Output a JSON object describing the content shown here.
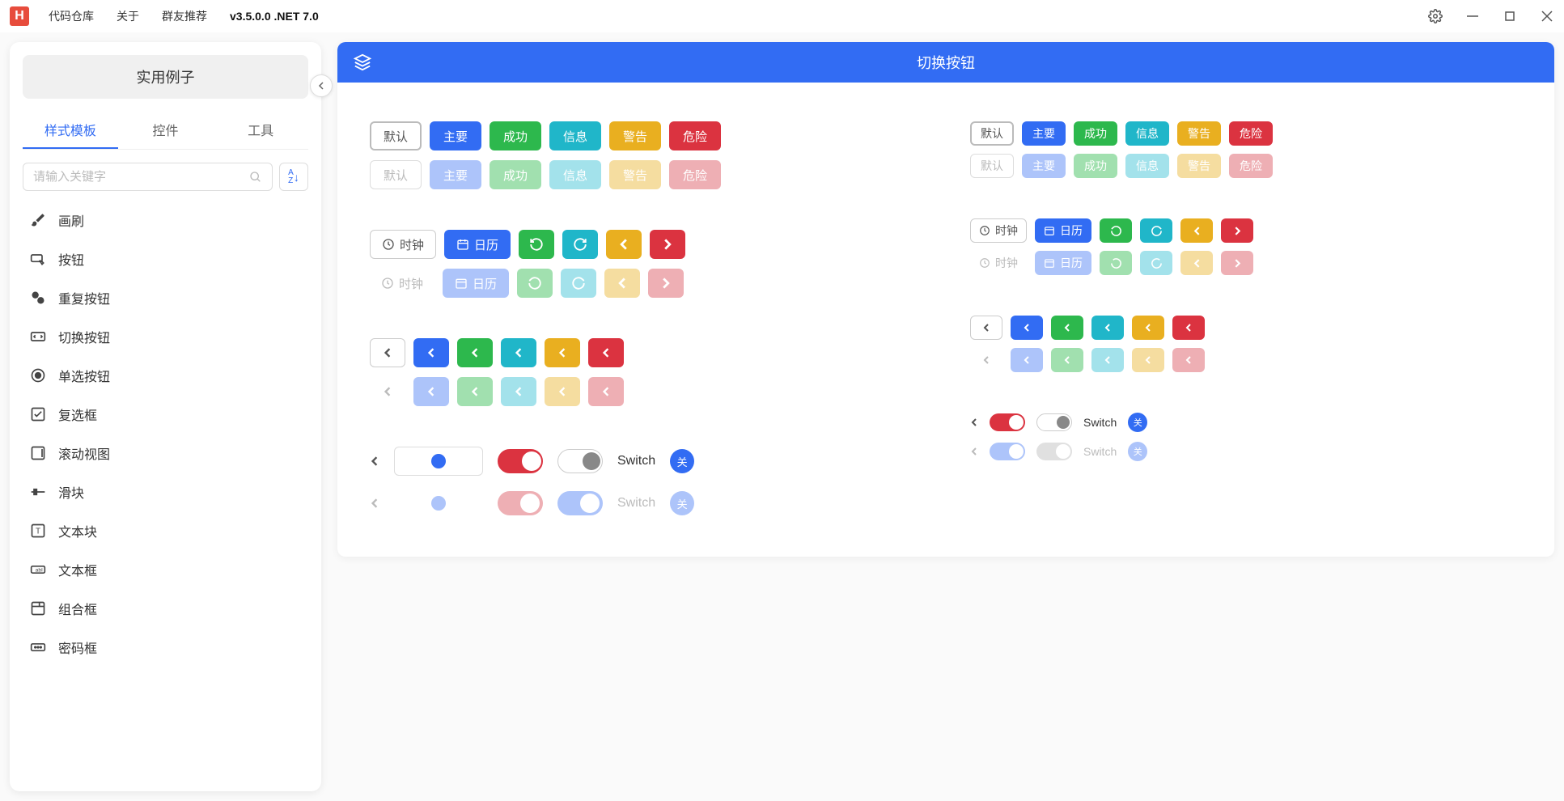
{
  "titlebar": {
    "logo": "H",
    "menu": [
      "代码仓库",
      "关于",
      "群友推荐"
    ],
    "version": "v3.5.0.0 .NET 7.0"
  },
  "sidebar": {
    "header": "实用例子",
    "tabs": [
      "样式模板",
      "控件",
      "工具"
    ],
    "active_tab": 0,
    "search_placeholder": "请输入关键字",
    "sort_label": "A↓",
    "items": [
      {
        "icon": "brush",
        "label": "画刷"
      },
      {
        "icon": "cursor",
        "label": "按钮"
      },
      {
        "icon": "repeat",
        "label": "重复按钮"
      },
      {
        "icon": "toggle",
        "label": "切换按钮"
      },
      {
        "icon": "radio",
        "label": "单选按钮"
      },
      {
        "icon": "check",
        "label": "复选框"
      },
      {
        "icon": "scroll",
        "label": "滚动视图"
      },
      {
        "icon": "slider",
        "label": "滑块"
      },
      {
        "icon": "textblock",
        "label": "文本块"
      },
      {
        "icon": "textbox",
        "label": "文本框"
      },
      {
        "icon": "group",
        "label": "组合框"
      },
      {
        "icon": "password",
        "label": "密码框"
      }
    ]
  },
  "panel": {
    "title": "切换按钮",
    "buttons": {
      "default": "默认",
      "primary": "主要",
      "success": "成功",
      "info": "信息",
      "warning": "警告",
      "danger": "危险"
    },
    "clock": "时钟",
    "calendar": "日历",
    "switch_label": "Switch",
    "close_label": "关"
  },
  "colors": {
    "primary": "#326cf3",
    "success": "#2db84d",
    "info": "#20b6c9",
    "warning": "#e9af20",
    "danger": "#db3340",
    "light_primary": "#adc4fa",
    "light_success": "#a1e0af",
    "light_info": "#a3e2eb",
    "light_warning": "#f5dda0",
    "light_danger": "#eeafb4"
  }
}
